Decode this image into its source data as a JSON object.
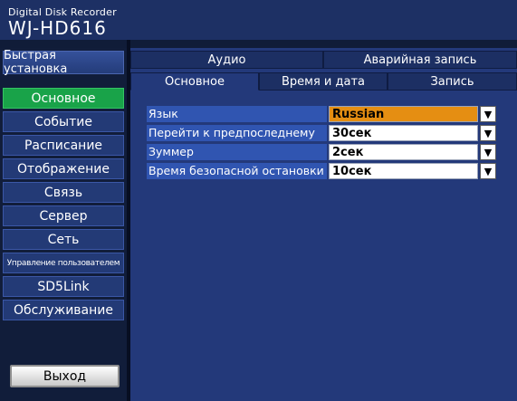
{
  "header": {
    "subtitle": "Digital Disk Recorder",
    "model": "WJ-HD616"
  },
  "sidebar": {
    "quick_setup": "Быстрая установка",
    "items": [
      {
        "label": "Основное",
        "active": true
      },
      {
        "label": "Событие"
      },
      {
        "label": "Расписание"
      },
      {
        "label": "Отображение"
      },
      {
        "label": "Связь"
      },
      {
        "label": "Сервер"
      },
      {
        "label": "Сеть"
      },
      {
        "label": "Управление пользователем"
      },
      {
        "label": "SD5Link"
      },
      {
        "label": "Обслуживание"
      }
    ],
    "exit_label": "Выход"
  },
  "tabs": {
    "row1": [
      {
        "label": "Аудио"
      },
      {
        "label": "Аварийная запись"
      }
    ],
    "row2": [
      {
        "label": "Основное",
        "active": true
      },
      {
        "label": "Время и дата"
      },
      {
        "label": "Запись"
      }
    ]
  },
  "settings": [
    {
      "label": "Язык",
      "value": "Russian",
      "focused": true
    },
    {
      "label": "Перейти к предпоследнему",
      "value": "30сек"
    },
    {
      "label": "Зуммер",
      "value": "2сек"
    },
    {
      "label": "Время безопасной остановки",
      "value": "10сек"
    }
  ],
  "icons": {
    "dropdown": "▼"
  },
  "colors": {
    "header_bg": "#1d3064",
    "active_menu": "#19a349",
    "focused_select": "#e58e12",
    "label_bg": "#3055b1"
  }
}
